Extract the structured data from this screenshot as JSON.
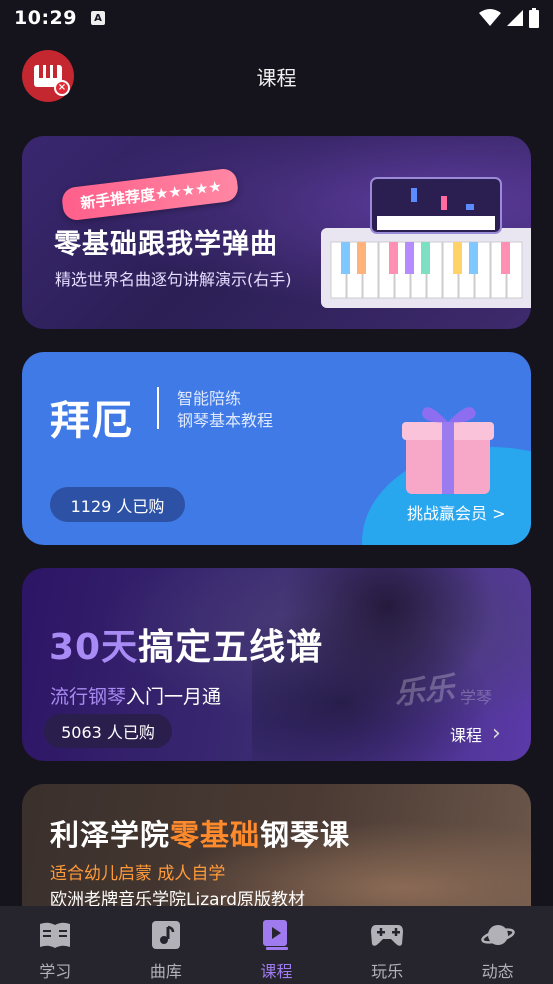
{
  "status_bar": {
    "time": "10:29",
    "notif_letter": "A"
  },
  "header": {
    "title": "课程",
    "avatar_badge": "×"
  },
  "courses": [
    {
      "tag": "新手推荐度★★★★★",
      "title": "零基础跟我学弹曲",
      "subtitle": "精选世界名曲逐句讲解演示(右手)"
    },
    {
      "title": "拜厄",
      "desc_line1": "智能陪练",
      "desc_line2": "钢琴基本教程",
      "purchased": "1129 人已购",
      "cta": "挑战赢会员 >"
    },
    {
      "title_hl": "30天",
      "title_rest": "搞定五线谱",
      "sub_hl": "流行钢琴",
      "sub_rest": "入门一月通",
      "purchased": "5063 人已购",
      "watermark": "乐乐",
      "watermark2": "学琴",
      "cta": "课程",
      "cta_arrow": "›"
    },
    {
      "title_part1": "利泽学院",
      "title_hl": "零基础",
      "title_part2": "钢琴课",
      "sub1": "适合幼儿启蒙 成人自学",
      "sub2": "欧洲老牌音乐学院Lizard原版教材"
    }
  ],
  "bottom_nav": [
    {
      "label": "学习",
      "icon": "book-icon",
      "active": false
    },
    {
      "label": "曲库",
      "icon": "music-note-icon",
      "active": false
    },
    {
      "label": "课程",
      "icon": "video-course-icon",
      "active": true
    },
    {
      "label": "玩乐",
      "icon": "gamepad-icon",
      "active": false
    },
    {
      "label": "动态",
      "icon": "planet-icon",
      "active": false
    }
  ],
  "colors": {
    "background": "#15131c",
    "nav_active": "#a07bf0",
    "nav_inactive": "#b3b1b8",
    "card2_blue": "#3f7ae6",
    "card4_orange": "#ff8a2b"
  }
}
